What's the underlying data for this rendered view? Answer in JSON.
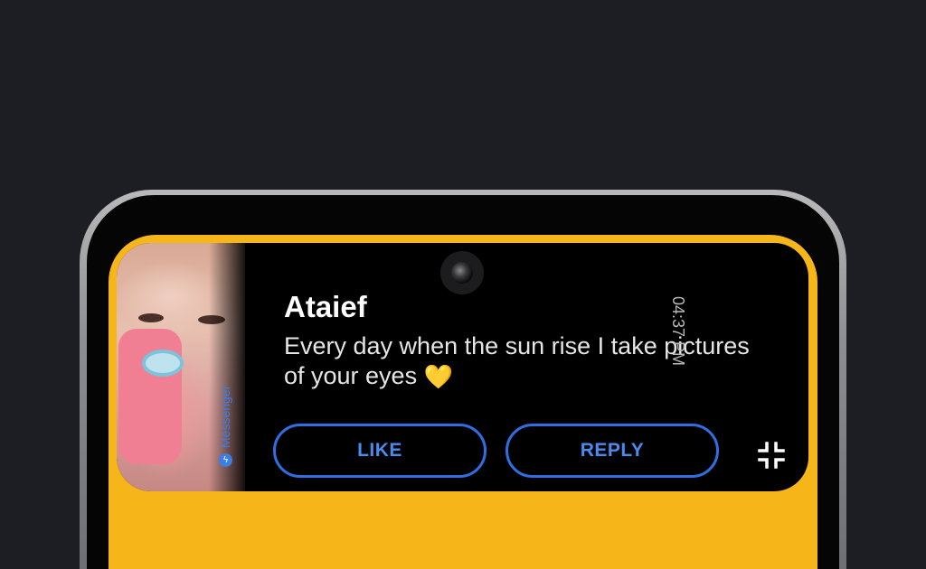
{
  "notification": {
    "sender": "Ataief",
    "message": "Every day when the sun rise I take pictures of your eyes",
    "emoji": "💛",
    "app_name": "Messenger",
    "time": "04:37 PM",
    "like_label": "LIKE",
    "reply_label": "REPLY"
  },
  "icons": {
    "app": "messenger-icon",
    "collapse": "collapse-icon",
    "camera": "front-camera-icon"
  },
  "colors": {
    "background": "#1d1e23",
    "screen_accent": "#f6b519",
    "button_border": "#2f6fe3",
    "button_text": "#4a8bf0",
    "app_label": "#3c7de8"
  }
}
